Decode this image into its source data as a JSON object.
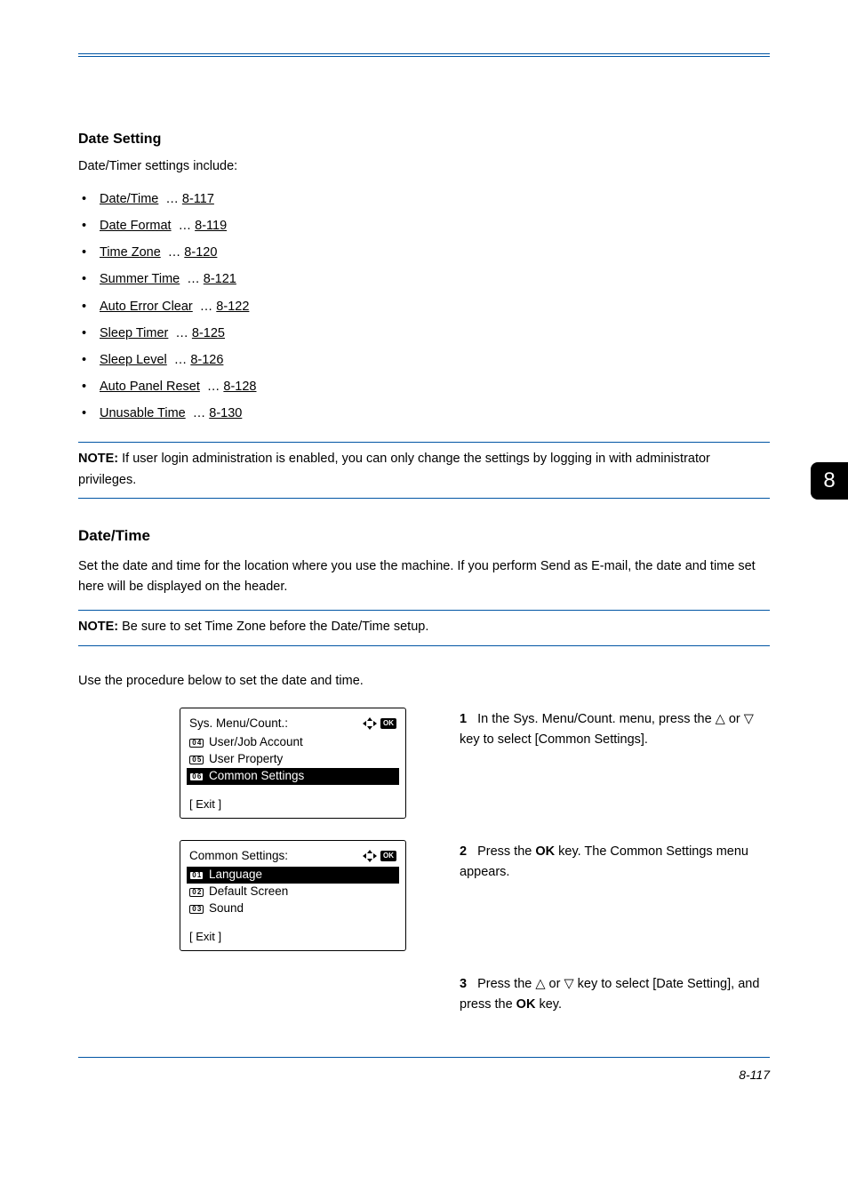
{
  "header": {
    "section_title": "Date Setting",
    "intro": "Date/Timer settings include:"
  },
  "bullets": [
    {
      "label": "Date/Time",
      "page": "8-117"
    },
    {
      "label": "Date Format",
      "page": "8-119"
    },
    {
      "label": "Time Zone",
      "page": "8-120"
    },
    {
      "label": "Summer Time",
      "page": "8-121"
    },
    {
      "label": "Auto Error Clear",
      "page": "8-122"
    },
    {
      "label": "Sleep Timer",
      "page": "8-125"
    },
    {
      "label": "Sleep Level",
      "page": "8-126"
    },
    {
      "label": "Auto Panel Reset",
      "page": "8-128"
    },
    {
      "label": "Unusable Time",
      "page": "8-130"
    }
  ],
  "note1": {
    "label": "NOTE:",
    "text": "If user login administration is enabled, you can only change the settings by logging in with administrator privileges."
  },
  "subsection": {
    "title": "Date/Time",
    "desc": "Set the date and time for the location where you use the machine. If you perform Send as E-mail, the date and time set here will be displayed on the header."
  },
  "note2": {
    "label": "NOTE:",
    "text": "Be sure to set Time Zone before the Date/Time setup."
  },
  "proc_intro": "Use the procedure below to set the date and time.",
  "screen1": {
    "title": "Sys. Menu/Count.:",
    "ok": "OK",
    "rows": [
      {
        "num": "0 4",
        "label": "User/Job Account"
      },
      {
        "num": "0 5",
        "label": "User Property"
      },
      {
        "num": "0 6",
        "label": "Common Settings"
      }
    ],
    "highlight_index": 2,
    "footer": "[ Exit  ]"
  },
  "screen2": {
    "title": "Common Settings:",
    "ok": "OK",
    "rows": [
      {
        "num": "0 1",
        "label": "Language"
      },
      {
        "num": "0 2",
        "label": "Default Screen"
      },
      {
        "num": "0 3",
        "label": "Sound"
      }
    ],
    "highlight_index": 0,
    "footer": "[ Exit  ]"
  },
  "steps": {
    "s1": {
      "num": "1",
      "t1": "In the Sys. Menu/Count. menu, press the ",
      "tri_up": "△",
      "or": " or ",
      "tri_down": "▽",
      "t2": " key to select [Common Settings]."
    },
    "s2": {
      "num": "2",
      "t1": "Press the ",
      "ok": "OK",
      "t2": " key. The Common Settings menu appears."
    },
    "s3": {
      "num": "3",
      "t1": "Press the ",
      "tri_up": "△",
      "or": " or ",
      "tri_down": "▽",
      "t2": " key to select [Date Setting], and press the ",
      "ok": "OK",
      "t3": " key."
    }
  },
  "tab_label": "8",
  "page_number": "8-117"
}
